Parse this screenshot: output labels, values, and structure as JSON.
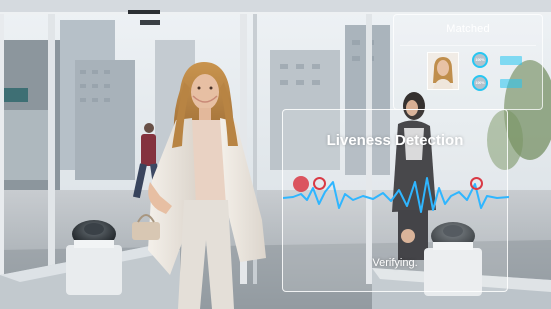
{
  "overlay": {
    "matched_label": "Matched",
    "match_score_1": "100%",
    "match_score_2": "100%",
    "accent_color": "#27c6f2",
    "liveness_title": "Liveness Detection",
    "status_text": "Verifying.",
    "wave_color": "#2fb6ff",
    "marker_color": "#d93a45"
  },
  "icons": {
    "matched_face": "face-thumbnail-icon",
    "score_ring": "circular-gauge-icon",
    "wave": "waveform-icon",
    "marker": "target-ring-icon"
  }
}
